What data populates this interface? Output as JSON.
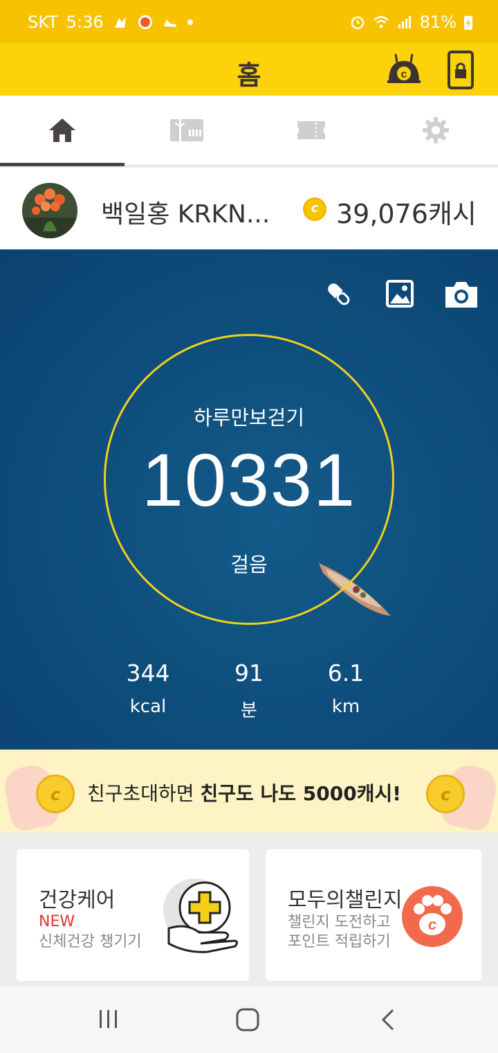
{
  "status_bar": {
    "carrier": "SKT",
    "time": "5:36",
    "battery": "81%"
  },
  "app_bar": {
    "title": "홈"
  },
  "tabs": [
    {
      "icon": "home-icon",
      "active": true
    },
    {
      "icon": "gift-card-icon",
      "active": false
    },
    {
      "icon": "ticket-icon",
      "active": false
    },
    {
      "icon": "gear-icon",
      "active": false
    }
  ],
  "profile": {
    "name": "백일홍 KRKN...",
    "cash": "39,076캐시"
  },
  "pedometer": {
    "label": "하루만보걷기",
    "steps": "10331",
    "unit": "걸음",
    "stats": [
      {
        "value": "344",
        "unit": "kcal"
      },
      {
        "value": "91",
        "unit": "분"
      },
      {
        "value": "6.1",
        "unit": "km"
      }
    ]
  },
  "banner": {
    "text": "친구초대하면 ",
    "bold": "친구도 나도 5000캐시!"
  },
  "cards": {
    "health": {
      "title": "건강케어",
      "badge": "NEW",
      "subtitle": "신체건강 챙기기"
    },
    "challenge": {
      "title": "모두의챌린지",
      "line1": "챌린지 도전하고",
      "line2": "포인트 적립하기"
    }
  },
  "colors": {
    "brand_yellow": "#fcd30a",
    "status_yellow": "#f7c300",
    "ring": "#f1d21a",
    "accent_red": "#e0342e",
    "challenge_orange": "#f26a4b"
  }
}
